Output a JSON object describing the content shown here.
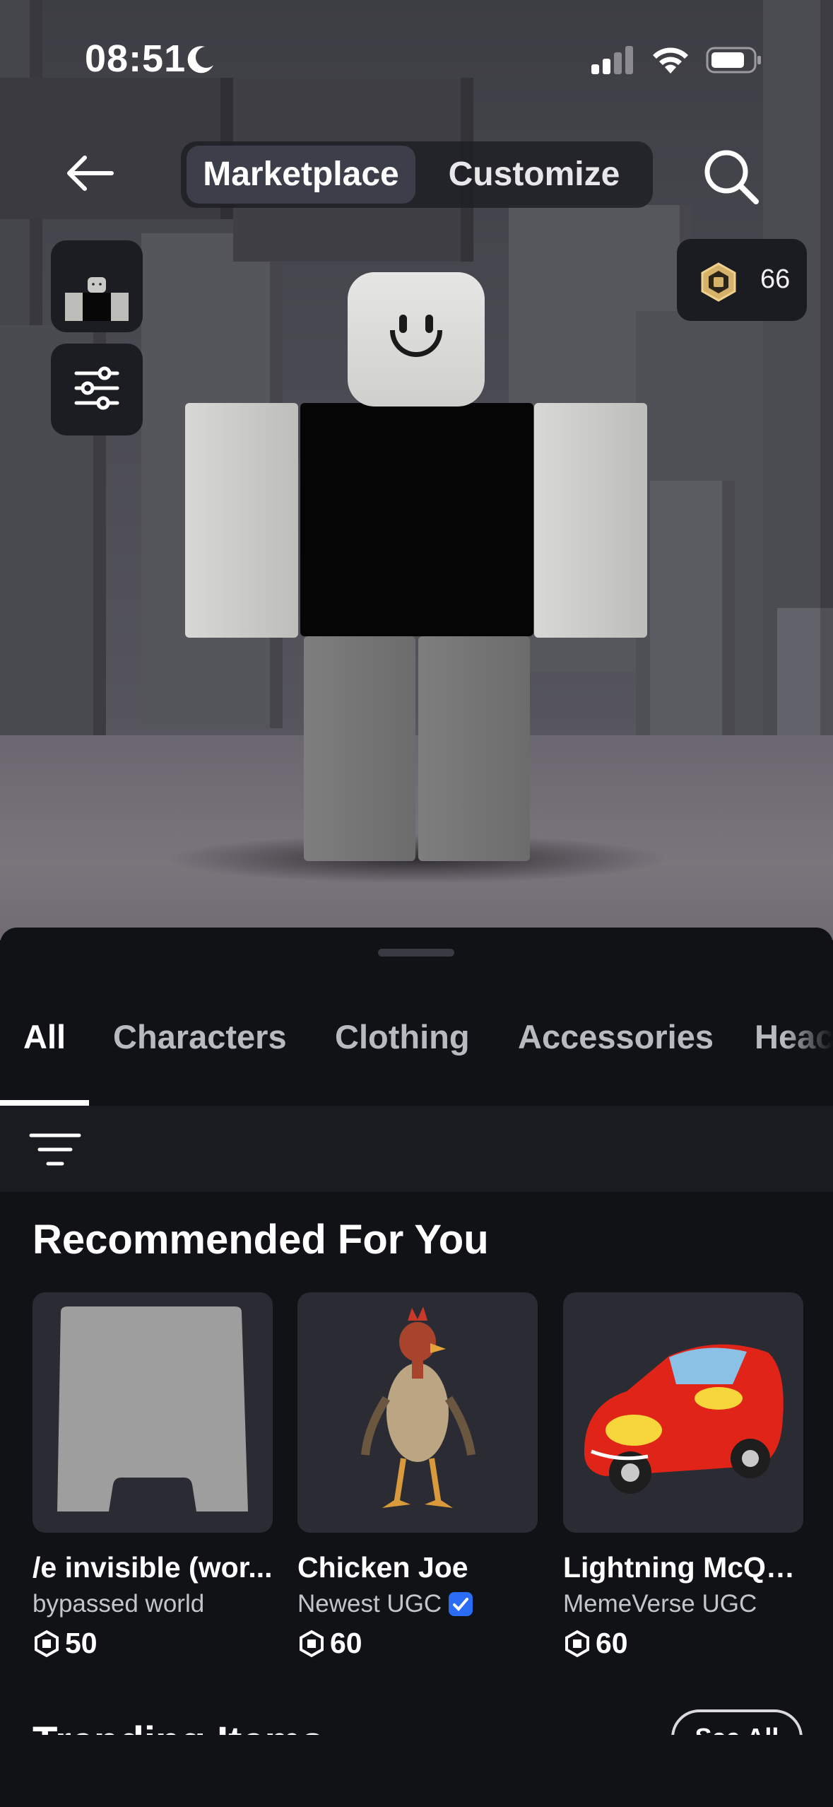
{
  "status_bar": {
    "time": "08:51"
  },
  "header": {
    "segments": [
      {
        "label": "Marketplace",
        "active": true
      },
      {
        "label": "Customize",
        "active": false
      }
    ],
    "robux_balance": "66"
  },
  "tabs": [
    {
      "label": "All",
      "active": true
    },
    {
      "label": "Characters"
    },
    {
      "label": "Clothing"
    },
    {
      "label": "Accessories"
    },
    {
      "label": "Heac"
    }
  ],
  "recommended": {
    "title": "Recommended For You",
    "items": [
      {
        "name": "/e invisible (wor...",
        "creator": "bypassed world",
        "price": "50",
        "verified": false
      },
      {
        "name": "Chicken Joe",
        "creator": "Newest UGC",
        "price": "60",
        "verified": true
      },
      {
        "name": "Lightning McQu...",
        "creator": "MemeVerse UGC",
        "price": "60",
        "verified": false
      }
    ]
  },
  "trending": {
    "title": "Trending Items",
    "see_all": "See All"
  },
  "icons": {
    "back": "arrow-left-icon",
    "search": "search-icon",
    "robux": "robux-icon",
    "filter": "sliders-icon",
    "sort": "sort-lines-icon",
    "moon": "moon-icon",
    "signal": "signal-icon",
    "wifi": "wifi-icon",
    "battery": "battery-icon"
  },
  "colors": {
    "background": "#111216",
    "accent_verified": "#2a6df4",
    "robux_gold": "#d4b26a"
  }
}
